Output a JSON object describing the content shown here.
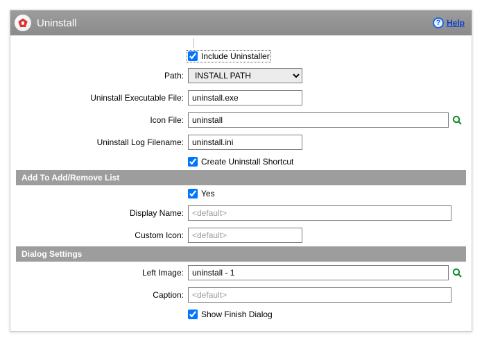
{
  "title": "Uninstall",
  "help_label": "Help",
  "include_uninstaller": {
    "label": "Include Uninstaller",
    "checked": true
  },
  "path": {
    "label": "Path:",
    "value": "INSTALL PATH"
  },
  "exe_file": {
    "label": "Uninstall Executable File:",
    "value": "uninstall.exe"
  },
  "icon_file": {
    "label": "Icon File:",
    "value": "uninstall"
  },
  "log_file": {
    "label": "Uninstall Log Filename:",
    "value": "uninstall.ini"
  },
  "create_shortcut": {
    "label": "Create Uninstall Shortcut",
    "checked": true
  },
  "sections": {
    "add_remove": "Add To Add/Remove List",
    "dialog": "Dialog Settings"
  },
  "yes": {
    "label": "Yes",
    "checked": true
  },
  "display_name": {
    "label": "Display Name:",
    "placeholder": "<default>"
  },
  "custom_icon": {
    "label": "Custom Icon:",
    "placeholder": "<default>"
  },
  "left_image": {
    "label": "Left Image:",
    "value": "uninstall - 1"
  },
  "caption": {
    "label": "Caption:",
    "placeholder": "<default>"
  },
  "show_finish": {
    "label": "Show Finish Dialog",
    "checked": true
  }
}
